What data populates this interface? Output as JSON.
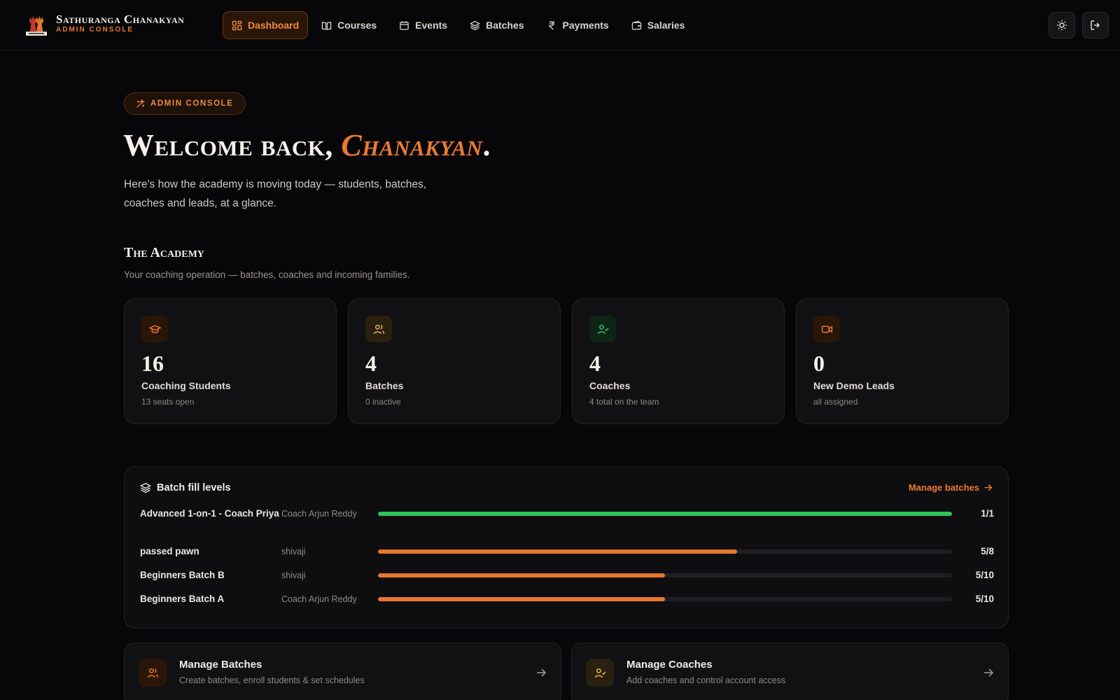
{
  "brand": {
    "name": "Sathuranga Chanakyan",
    "sub": "ADMIN CONSOLE"
  },
  "nav": [
    {
      "label": "Dashboard",
      "icon": "dashboard-icon",
      "active": true
    },
    {
      "label": "Courses",
      "icon": "book-icon"
    },
    {
      "label": "Events",
      "icon": "calendar-icon"
    },
    {
      "label": "Batches",
      "icon": "layers-icon"
    },
    {
      "label": "Payments",
      "icon": "rupee-icon"
    },
    {
      "label": "Salaries",
      "icon": "wallet-icon"
    }
  ],
  "hero": {
    "pill": "ADMIN CONSOLE",
    "welcome_prefix": "Welcome back, ",
    "welcome_name": "Chanakyan",
    "welcome_suffix": ".",
    "lede": "Here's how the academy is moving today — students, batches, coaches and leads, at a glance."
  },
  "section": {
    "title": "The Academy",
    "sub": "Your coaching operation — batches, coaches and incoming families."
  },
  "stats": [
    {
      "value": "16",
      "label": "Coaching Students",
      "sub": "13 seats open",
      "icon": "graduation-cap-icon",
      "color": "#e8772e",
      "bg": "#2a1609"
    },
    {
      "value": "4",
      "label": "Batches",
      "sub": "0 inactive",
      "icon": "users-icon",
      "color": "#e3b15a",
      "bg": "#2a2010"
    },
    {
      "value": "4",
      "label": "Coaches",
      "sub": "4 total on the team",
      "icon": "user-check-icon",
      "color": "#38c566",
      "bg": "#0f2416"
    },
    {
      "value": "0",
      "label": "New Demo Leads",
      "sub": "all assigned",
      "icon": "video-icon",
      "color": "#e8772e",
      "bg": "#2a1609"
    }
  ],
  "batch_fill": {
    "title": "Batch fill levels",
    "link": "Manage batches",
    "rows": [
      {
        "name": "Advanced 1-on-1 - Coach Priya",
        "coach": "Coach Arjun Reddy",
        "count": "1/1",
        "fraction": 1.0,
        "color": "#2fc45a"
      },
      {
        "name": "passed pawn",
        "coach": "shivaji",
        "count": "5/8",
        "fraction": 0.625,
        "color": "#e8772e"
      },
      {
        "name": "Beginners Batch B",
        "coach": "shivaji",
        "count": "5/10",
        "fraction": 0.5,
        "color": "#e8772e"
      },
      {
        "name": "Beginners Batch A",
        "coach": "Coach Arjun Reddy",
        "count": "5/10",
        "fraction": 0.5,
        "color": "#e8772e"
      }
    ]
  },
  "actions": [
    {
      "title": "Manage Batches",
      "sub": "Create batches, enroll students & set schedules",
      "icon": "users-icon",
      "color": "#e8772e"
    },
    {
      "title": "Manage Coaches",
      "sub": "Add coaches and control account access",
      "icon": "user-check-icon",
      "color": "#e3b15a"
    }
  ]
}
